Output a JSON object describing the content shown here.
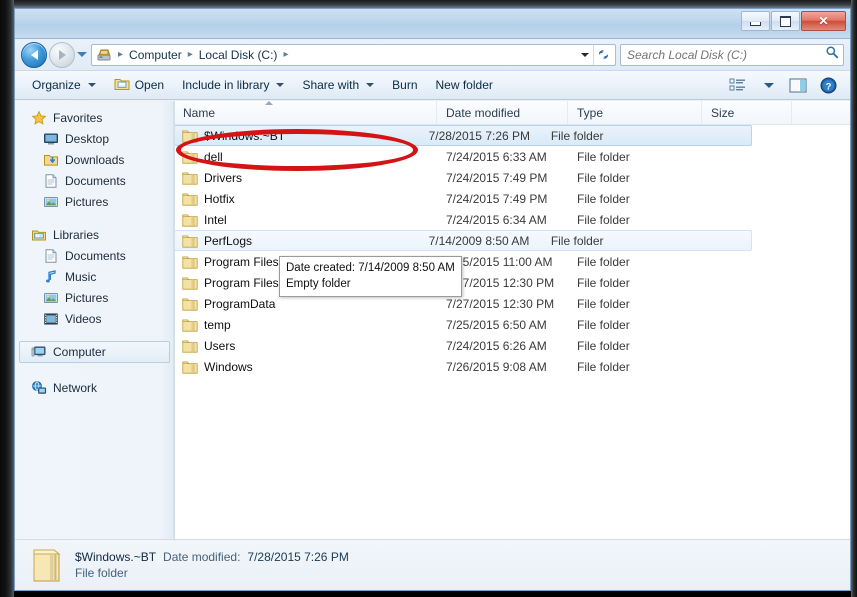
{
  "window": {
    "title": "",
    "buttons": {
      "minimize": "–",
      "maximize": "□",
      "close": "✕"
    }
  },
  "address": {
    "crumbs": [
      "Computer",
      "Local Disk (C:)"
    ],
    "separator": "▸",
    "computer_icon": "computer-drive-icon",
    "dropdown_icon": "chevron-down-icon",
    "refresh_icon": "refresh-icon",
    "refresh_glyph": "↻"
  },
  "search": {
    "placeholder": "Search Local Disk (C:)",
    "value": "",
    "icon": "search-icon"
  },
  "nav_buttons": {
    "back": "back-button",
    "forward": "forward-button",
    "recent_pages": "recent-pages-dropdown"
  },
  "toolbar": {
    "items": [
      {
        "label": "Organize",
        "caret": true,
        "icon": null
      },
      {
        "label": "Open",
        "caret": false,
        "icon": "open-folder-icon"
      },
      {
        "label": "Include in library",
        "caret": true,
        "icon": null
      },
      {
        "label": "Share with",
        "caret": true,
        "icon": null
      },
      {
        "label": "Burn",
        "caret": false,
        "icon": null
      },
      {
        "label": "New folder",
        "caret": false,
        "icon": null
      }
    ],
    "right_icons": [
      {
        "name": "change-view-icon"
      },
      {
        "name": "view-dropdown-caret"
      },
      {
        "name": "preview-pane-icon"
      },
      {
        "name": "help-icon",
        "glyph": "?"
      }
    ]
  },
  "sidebar": {
    "groups": [
      {
        "header": {
          "label": "Favorites",
          "icon": "star-icon"
        },
        "items": [
          {
            "label": "Desktop",
            "icon": "desktop-icon"
          },
          {
            "label": "Downloads",
            "icon": "downloads-icon"
          },
          {
            "label": "Documents",
            "icon": "document-icon"
          },
          {
            "label": "Pictures",
            "icon": "pictures-icon"
          }
        ]
      },
      {
        "header": {
          "label": "Libraries",
          "icon": "library-icon"
        },
        "items": [
          {
            "label": "Documents",
            "icon": "document-icon"
          },
          {
            "label": "Music",
            "icon": "music-note-icon"
          },
          {
            "label": "Pictures",
            "icon": "pictures-icon"
          },
          {
            "label": "Videos",
            "icon": "video-icon"
          }
        ]
      }
    ],
    "standalone": [
      {
        "label": "Computer",
        "icon": "computer-icon",
        "selected": true
      },
      {
        "label": "Network",
        "icon": "network-icon",
        "selected": false
      }
    ]
  },
  "filelist": {
    "columns": [
      "Name",
      "Date modified",
      "Type",
      "Size"
    ],
    "sort_column": "Name",
    "sort_direction": "ascending",
    "rows": [
      {
        "name": "$Windows.~BT",
        "date": "7/28/2015 7:26 PM",
        "type": "File folder",
        "size": "",
        "state": "selected"
      },
      {
        "name": "dell",
        "date": "7/24/2015 6:33 AM",
        "type": "File folder",
        "size": "",
        "state": "normal"
      },
      {
        "name": "Drivers",
        "date": "7/24/2015 7:49 PM",
        "type": "File folder",
        "size": "",
        "state": "normal"
      },
      {
        "name": "Hotfix",
        "date": "7/24/2015 7:49 PM",
        "type": "File folder",
        "size": "",
        "state": "normal"
      },
      {
        "name": "Intel",
        "date": "7/24/2015 6:34 AM",
        "type": "File folder",
        "size": "",
        "state": "normal"
      },
      {
        "name": "PerfLogs",
        "date": "7/14/2009 8:50 AM",
        "type": "File folder",
        "size": "",
        "state": "hovered"
      },
      {
        "name": "Program Files",
        "date": "7/25/2015 11:00 AM",
        "type": "File folder",
        "size": "",
        "state": "normal"
      },
      {
        "name": "Program Files (x86)",
        "date": "7/27/2015 12:30 PM",
        "type": "File folder",
        "size": "",
        "state": "normal"
      },
      {
        "name": "ProgramData",
        "date": "7/27/2015 12:30 PM",
        "type": "File folder",
        "size": "",
        "state": "normal"
      },
      {
        "name": "temp",
        "date": "7/25/2015 6:50 AM",
        "type": "File folder",
        "size": "",
        "state": "normal"
      },
      {
        "name": "Users",
        "date": "7/24/2015 6:26 AM",
        "type": "File folder",
        "size": "",
        "state": "normal"
      },
      {
        "name": "Windows",
        "date": "7/26/2015 9:08 AM",
        "type": "File folder",
        "size": "",
        "state": "normal"
      }
    ]
  },
  "tooltip": {
    "line1": "Date created: 7/14/2009 8:50 AM",
    "line2": "Empty folder"
  },
  "annotation": {
    "shape": "ellipse",
    "color": "#d41414",
    "targets": "$Windows.~BT"
  },
  "statusbar": {
    "icon": "large-folder-icon",
    "name": "$Windows.~BT",
    "date_label": "Date modified:",
    "date_value": "7/28/2015 7:26 PM",
    "type": "File folder"
  }
}
